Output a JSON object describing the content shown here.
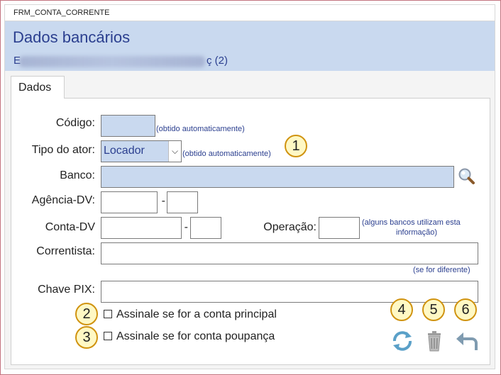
{
  "window": {
    "title": "FRM_CONTA_CORRENTE"
  },
  "header": {
    "title": "Dados bancários",
    "subtitle_suffix": "ç (2)"
  },
  "tabs": [
    {
      "label": "Dados"
    }
  ],
  "form": {
    "codigo": {
      "label": "Código:",
      "note": "(obtido automaticamente)",
      "value": ""
    },
    "tipo_ator": {
      "label": "Tipo do ator:",
      "selected": "Locador",
      "note": "(obtido automaticamente)"
    },
    "banco": {
      "label": "Banco:",
      "value": ""
    },
    "agencia": {
      "label": "Agência-DV:",
      "separator": "-"
    },
    "conta": {
      "label": "Conta-DV",
      "separator": "-"
    },
    "operacao": {
      "label": "Operação:",
      "note_line1": "(alguns bancos utilizam esta",
      "note_line2": "informação)"
    },
    "correntista": {
      "label": "Correntista:",
      "note": "(se for diferente)"
    },
    "chave_pix": {
      "label": "Chave PIX:"
    },
    "conta_principal": {
      "label": "Assinale se for a conta principal",
      "checked": false
    },
    "conta_poupanca": {
      "label": "Assinale se for conta poupança",
      "checked": false
    }
  },
  "badges": [
    "1",
    "2",
    "3",
    "4",
    "5",
    "6"
  ],
  "actions": {
    "refresh": {
      "icon": "refresh-icon"
    },
    "delete": {
      "icon": "trash-icon"
    },
    "back": {
      "icon": "undo-arrow-icon"
    },
    "search": {
      "icon": "magnifier-icon"
    }
  },
  "colors": {
    "accent_blue": "#c9d9ef",
    "title_text": "#2b3f8f",
    "badge_fill": "#fff8c4",
    "badge_border": "#d09310"
  }
}
